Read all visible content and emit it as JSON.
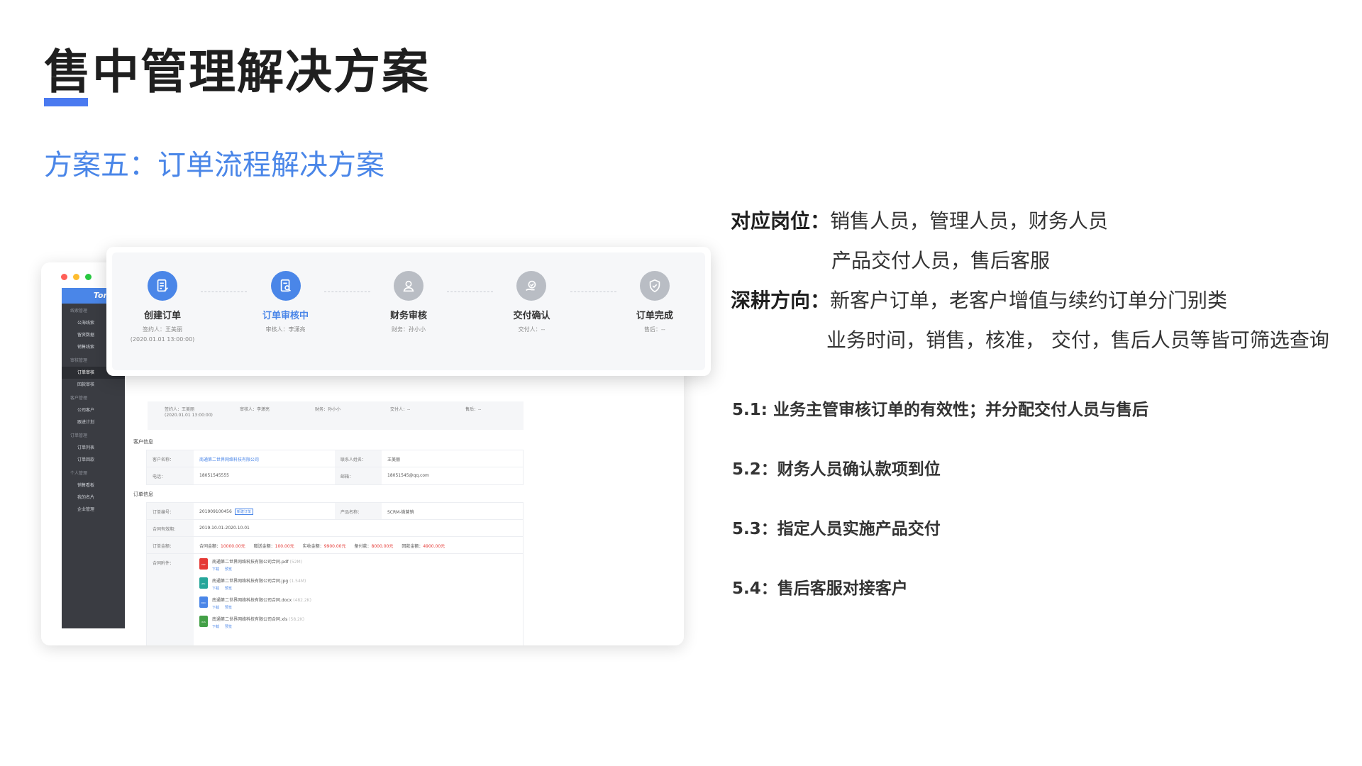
{
  "header": {
    "title": "售中管理解决方案",
    "subtitle": "方案五：订单流程解决方案"
  },
  "colors": {
    "accent": "#4a86e8",
    "title_bar": "#4a7af0",
    "gray_step": "#b9bdc4"
  },
  "app": {
    "logo": "Tonrai",
    "sidebar": [
      {
        "type": "group",
        "label": "线索管理"
      },
      {
        "type": "item",
        "label": "公海线索"
      },
      {
        "type": "item",
        "label": "留资数据"
      },
      {
        "type": "item",
        "label": "销售线索"
      },
      {
        "type": "group",
        "label": "审核管理"
      },
      {
        "type": "item",
        "label": "订单审核",
        "active": true
      },
      {
        "type": "item",
        "label": "回款审核"
      },
      {
        "type": "group",
        "label": "客户管理"
      },
      {
        "type": "item",
        "label": "公司客户"
      },
      {
        "type": "item",
        "label": "跟进计划"
      },
      {
        "type": "group",
        "label": "订单管理"
      },
      {
        "type": "item",
        "label": "订单列表"
      },
      {
        "type": "item",
        "label": "订单回款"
      },
      {
        "type": "group",
        "label": "个人管理"
      },
      {
        "type": "item",
        "label": "销售看板"
      },
      {
        "type": "item",
        "label": "我的名片"
      },
      {
        "type": "item",
        "label": "企业管理"
      }
    ],
    "ghost_row": [
      "签约人：王美丽",
      "(2020.01.01 13:00:00)",
      "审核人：李潇亮",
      "财务：孙小小",
      "交付人：--",
      "售后：--"
    ],
    "customer_section": "客户信息",
    "customer": {
      "name_label": "客户名称：",
      "name_value": "南通第二世界网络科技有限公司",
      "contact_label": "联系人姓名：",
      "contact_value": "王美丽",
      "phone_label": "电话：",
      "phone_value": "18051545555",
      "email_label": "邮箱：",
      "email_value": "18051545@qq.com"
    },
    "order_section": "订单信息",
    "order": {
      "no_label": "订单编号：",
      "no_value": "201909100456",
      "no_tag": "新建订单",
      "product_label": "产品名称：",
      "product_value": "SCRM-微营销",
      "period_label": "合同有效期：",
      "period_value": "2019.10.01-2020.10.01",
      "amount_label": "订单金额：",
      "amounts": [
        {
          "k": "合同金额：",
          "v": "10000.00元"
        },
        {
          "k": "赠送金额：",
          "v": "100.00元"
        },
        {
          "k": "实收金额：",
          "v": "9900.00元"
        },
        {
          "k": "备付款：",
          "v": "8000.00元"
        },
        {
          "k": "回款金额：",
          "v": "4900.00元"
        }
      ],
      "files_label": "合同附件：",
      "files": [
        {
          "name": "南通第二世界网络科技有限公司合同.pdf",
          "size": "(52M)",
          "color": "#e53935",
          "ext": "PDF"
        },
        {
          "name": "南通第二世界网络科技有限公司合同.jpg",
          "size": "(1.54M)",
          "color": "#26a69a",
          "ext": "JPG"
        },
        {
          "name": "南通第二世界网络科技有限公司合同.docx",
          "size": "(482.2K)",
          "color": "#4a86e8",
          "ext": "DOC"
        },
        {
          "name": "南通第二世界网络科技有限公司合同.xls",
          "size": "(58.2K)",
          "color": "#43a047",
          "ext": "XLS"
        }
      ],
      "download": "下载",
      "preview": "预览"
    }
  },
  "steps": [
    {
      "label": "创建订单",
      "detail1": "签约人：王美丽",
      "detail2": "(2020.01.01 13:00:00)",
      "state": "done",
      "icon": "doc-edit-icon"
    },
    {
      "label": "订单审核中",
      "detail1": "审核人：李潇亮",
      "detail2": "",
      "state": "active",
      "icon": "doc-search-icon"
    },
    {
      "label": "财务审核",
      "detail1": "财务：孙小小",
      "detail2": "",
      "state": "pending",
      "icon": "user-icon"
    },
    {
      "label": "交付确认",
      "detail1": "交付人：--",
      "detail2": "",
      "state": "pending",
      "icon": "hand-check-icon"
    },
    {
      "label": "订单完成",
      "detail1": "售后：--",
      "detail2": "",
      "state": "pending",
      "icon": "shield-check-icon"
    }
  ],
  "right": {
    "role_key": "对应岗位：",
    "role_line1": "销售人员，管理人员，财务人员",
    "role_line2": "产品交付人员，售后客服",
    "dir_key": "深耕方向：",
    "dir_line1": "新客户订单，老客户增值与续约订单分门别类",
    "dir_line2": "业务时间，销售，核准， 交付，售后人员等皆可筛选查询",
    "points": [
      "5.1: 业务主管审核订单的有效性；并分配交付人员与售后",
      "5.2：财务人员确认款项到位",
      "5.3：指定人员实施产品交付",
      "5.4：售后客服对接客户"
    ]
  }
}
